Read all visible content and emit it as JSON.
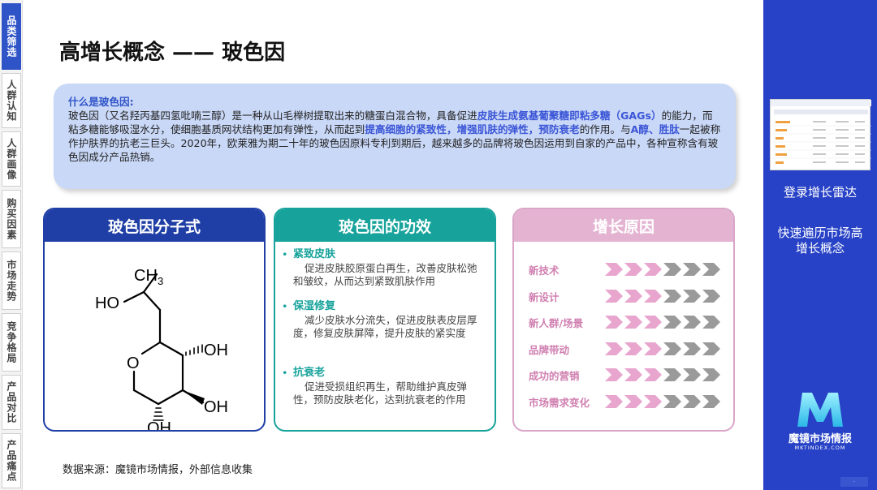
{
  "nav": [
    {
      "label": "品类筛选",
      "active": true
    },
    {
      "label": "人群认知",
      "active": false
    },
    {
      "label": "人群画像",
      "active": false
    },
    {
      "label": "购买因素",
      "active": false
    },
    {
      "label": "市场走势",
      "active": false
    },
    {
      "label": "竞争格局",
      "active": false
    },
    {
      "label": "产品对比",
      "active": false
    },
    {
      "label": "产品痛点",
      "active": false
    }
  ],
  "title": "高增长概念 —— 玻色因",
  "intro": {
    "heading": "什么是玻色因:",
    "t1": "玻色因（又名羟丙基四氢吡喃三醇）是一种从山毛榉树提取出来的糖蛋白混合物，具备促进",
    "h1": "皮肤生成氨基葡聚糖即粘多糖（GAGs）",
    "t2": "的能力，而粘多糖能够吸湿水分，使细胞基质网状结构更加有弹性，从而起到",
    "h2": "提高细胞的紧致性，增强肌肤的弹性，预防衰老",
    "t3": "的作用。与",
    "h3": "A醇、胜肽",
    "t4": "一起被称作护肤界的抗老三巨头。2020年，欧莱雅为期二十年的玻色因原料专利到期后，越来越多的品牌将玻色因运用到自家的产品中，各种宣称含有玻色因成分产品热销。"
  },
  "cards": {
    "molecule": {
      "title": "玻色因分子式",
      "labels": {
        "ch3": "CH",
        "ch3_sub": "3",
        "ho": "HO",
        "o": "O",
        "oh1": "OH",
        "oh2": "OH",
        "oh3": "OH"
      }
    },
    "efficacy": {
      "title": "玻色因的功效",
      "items": [
        {
          "title": "紧致皮肤",
          "desc": "促进皮肤胶原蛋白再生，改善皮肤松弛和皱纹，从而达到紧致肌肤作用"
        },
        {
          "title": "保湿修复",
          "desc": "减少皮肤水分流失，促进皮肤表皮层厚度，修复皮肤屏障，提升皮肤的紧实度"
        },
        {
          "title": "抗衰老",
          "desc": "促进受损组织再生，帮助维护真皮弹性，预防皮肤老化，达到抗衰老的作用"
        }
      ]
    },
    "growth": {
      "title": "增长原因",
      "reasons": [
        {
          "label": "新技术",
          "level": 3
        },
        {
          "label": "新设计",
          "level": 3
        },
        {
          "label": "新人群/场景",
          "level": 3
        },
        {
          "label": "品牌带动",
          "level": 3
        },
        {
          "label": "成功的营销",
          "level": 3
        },
        {
          "label": "市场需求变化",
          "level": 3
        }
      ],
      "arrow_total": 6
    }
  },
  "source": "数据来源：魔镜市场情报，外部信息收集",
  "right_panel": {
    "login_text": "登录增长雷达",
    "tagline": "快速遍历市场高增长概念",
    "brand_name": "魔镜市场情报",
    "brand_url": "MKTINDEX.COM"
  },
  "colors": {
    "accent_blue": "#2742c6",
    "teal": "#17a39b",
    "pink": "#e4b3d2",
    "arrow_active": "#e8a6cf",
    "arrow_inactive": "#9a9a9a"
  }
}
